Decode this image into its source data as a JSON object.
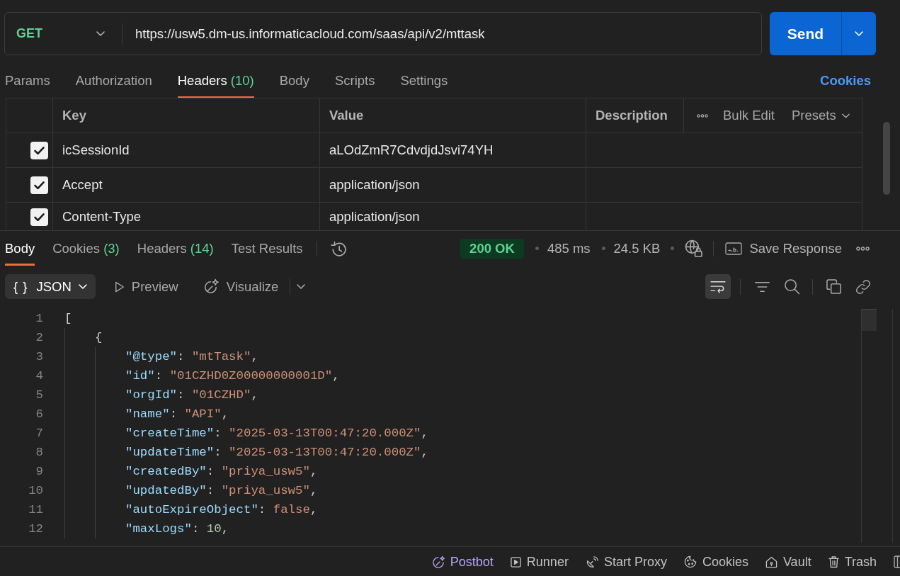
{
  "request": {
    "method": "GET",
    "url": "https://usw5.dm-us.informaticacloud.com/saas/api/v2/mttask",
    "send_label": "Send"
  },
  "request_tabs": [
    {
      "label": "Params",
      "selected": false
    },
    {
      "label": "Authorization",
      "selected": false
    },
    {
      "label": "Headers",
      "count": "(10)",
      "selected": true
    },
    {
      "label": "Body",
      "selected": false
    },
    {
      "label": "Scripts",
      "selected": false
    },
    {
      "label": "Settings",
      "selected": false
    }
  ],
  "cookies_link": "Cookies",
  "headers_table": {
    "columns": [
      "Key",
      "Value",
      "Description"
    ],
    "bulk_edit": "Bulk Edit",
    "presets": "Presets",
    "rows": [
      {
        "checked": true,
        "key": "icSessionId",
        "value": "aLOdZmR7CdvdjdJsvi74YH"
      },
      {
        "checked": true,
        "key": "Accept",
        "value": "application/json"
      },
      {
        "checked": true,
        "key": "Content-Type",
        "value": "application/json"
      }
    ]
  },
  "response": {
    "tabs": [
      {
        "label": "Body",
        "selected": true
      },
      {
        "label": "Cookies",
        "count": "(3)",
        "selected": false
      },
      {
        "label": "Headers",
        "count": "(14)",
        "selected": false
      },
      {
        "label": "Test Results",
        "selected": false
      }
    ],
    "status": "200 OK",
    "time": "485 ms",
    "size": "24.5 KB",
    "save_response": "Save Response",
    "body_view": {
      "formats": [
        {
          "kind": "dropdown",
          "glyph": "{ }",
          "label": "JSON",
          "selected": true
        },
        {
          "kind": "button",
          "label": "Preview",
          "selected": false
        },
        {
          "kind": "button",
          "label": "Visualize",
          "selected": false
        }
      ],
      "wrap_lines": true,
      "lines": [
        {
          "number": "1",
          "tokens": [
            {
              "kind": "punct",
              "text": "["
            }
          ],
          "children": [
            {
              "number": "2",
              "tokens": [
                {
                  "kind": "punct",
                  "text": "{"
                }
              ],
              "children": [
                {
                  "number": "3",
                  "tokens": [
                    {
                      "kind": "key",
                      "text": "\"@type\""
                    },
                    {
                      "kind": "punct",
                      "text": ": "
                    },
                    {
                      "kind": "string",
                      "text": "\"mtTask\""
                    },
                    {
                      "kind": "punct",
                      "text": ","
                    }
                  ]
                },
                {
                  "number": "4",
                  "tokens": [
                    {
                      "kind": "key",
                      "text": "\"id\""
                    },
                    {
                      "kind": "punct",
                      "text": ": "
                    },
                    {
                      "kind": "string",
                      "text": "\"01CZHD0Z00000000001D\""
                    },
                    {
                      "kind": "punct",
                      "text": ","
                    }
                  ]
                },
                {
                  "number": "5",
                  "tokens": [
                    {
                      "kind": "key",
                      "text": "\"orgId\""
                    },
                    {
                      "kind": "punct",
                      "text": ": "
                    },
                    {
                      "kind": "string",
                      "text": "\"01CZHD\""
                    },
                    {
                      "kind": "punct",
                      "text": ","
                    }
                  ]
                },
                {
                  "number": "6",
                  "tokens": [
                    {
                      "kind": "key",
                      "text": "\"name\""
                    },
                    {
                      "kind": "punct",
                      "text": ": "
                    },
                    {
                      "kind": "string",
                      "text": "\"API\""
                    },
                    {
                      "kind": "punct",
                      "text": ","
                    }
                  ]
                },
                {
                  "number": "7",
                  "tokens": [
                    {
                      "kind": "key",
                      "text": "\"createTime\""
                    },
                    {
                      "kind": "punct",
                      "text": ": "
                    },
                    {
                      "kind": "string",
                      "text": "\"2025-03-13T00:47:20.000Z\""
                    },
                    {
                      "kind": "punct",
                      "text": ","
                    }
                  ]
                },
                {
                  "number": "8",
                  "tokens": [
                    {
                      "kind": "key",
                      "text": "\"updateTime\""
                    },
                    {
                      "kind": "punct",
                      "text": ": "
                    },
                    {
                      "kind": "string",
                      "text": "\"2025-03-13T00:47:20.000Z\""
                    },
                    {
                      "kind": "punct",
                      "text": ","
                    }
                  ]
                },
                {
                  "number": "9",
                  "tokens": [
                    {
                      "kind": "key",
                      "text": "\"createdBy\""
                    },
                    {
                      "kind": "punct",
                      "text": ": "
                    },
                    {
                      "kind": "string",
                      "text": "\"priya_usw5\""
                    },
                    {
                      "kind": "punct",
                      "text": ","
                    }
                  ]
                },
                {
                  "number": "10",
                  "tokens": [
                    {
                      "kind": "key",
                      "text": "\"updatedBy\""
                    },
                    {
                      "kind": "punct",
                      "text": ": "
                    },
                    {
                      "kind": "string",
                      "text": "\"priya_usw5\""
                    },
                    {
                      "kind": "punct",
                      "text": ","
                    }
                  ]
                },
                {
                  "number": "11",
                  "tokens": [
                    {
                      "kind": "key",
                      "text": "\"autoExpireObject\""
                    },
                    {
                      "kind": "punct",
                      "text": ": "
                    },
                    {
                      "kind": "literal",
                      "text": "false"
                    },
                    {
                      "kind": "punct",
                      "text": ","
                    }
                  ]
                },
                {
                  "number": "12",
                  "tokens": [
                    {
                      "kind": "key",
                      "text": "\"maxLogs\""
                    },
                    {
                      "kind": "punct",
                      "text": ": "
                    },
                    {
                      "kind": "number",
                      "text": "10"
                    },
                    {
                      "kind": "punct",
                      "text": ","
                    }
                  ]
                }
              ]
            }
          ]
        }
      ]
    }
  },
  "status_bar": {
    "items": [
      {
        "label": "Postbot",
        "color": "#b8a6f6"
      },
      {
        "label": "Runner",
        "color": "#c2c2c2"
      },
      {
        "label": "Start Proxy",
        "color": "#c2c2c2"
      },
      {
        "label": "Cookies",
        "color": "#c2c2c2"
      },
      {
        "label": "Vault",
        "color": "#c2c2c2"
      },
      {
        "label": "Trash",
        "color": "#c2c2c2"
      }
    ]
  }
}
